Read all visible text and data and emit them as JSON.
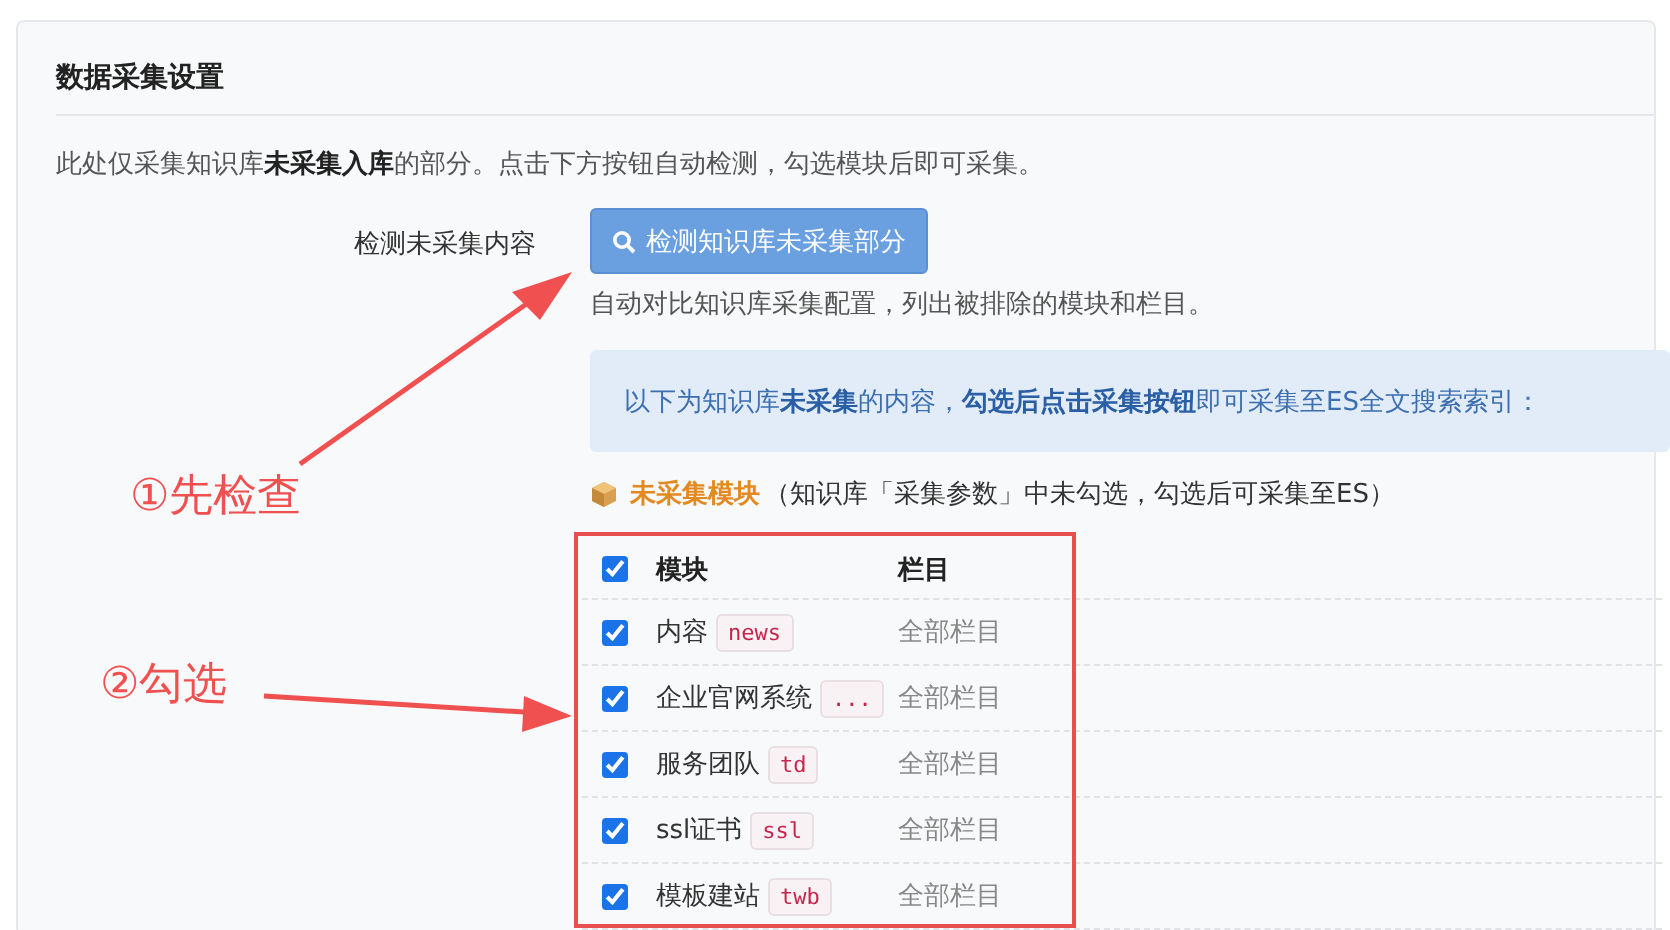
{
  "panel": {
    "title": "数据采集设置",
    "description": "此处仅采集知识库**未采集入库**的部分。点击下方按钮自动检测，勾选模块后即可采集。"
  },
  "detect": {
    "label": "检测未采集内容",
    "button": "检测知识库未采集部分",
    "help": "自动对比知识库采集配置，列出被排除的模块和栏目。"
  },
  "notice": "以下为知识库**未采集**的内容，**勾选后点击采集按钮**即可采集至ES全文搜索索引：",
  "section": {
    "title": "未采集模块",
    "note": "（知识库「采集参数」中未勾选，勾选后可采集至ES）"
  },
  "table": {
    "header_checked": true,
    "columns": [
      "模块",
      "栏目"
    ],
    "rows": [
      {
        "module": "内容",
        "code": "news",
        "column": "全部栏目",
        "checked": true
      },
      {
        "module": "企业官网系统",
        "code": "...",
        "column": "全部栏目",
        "checked": true
      },
      {
        "module": "服务团队",
        "code": "td",
        "column": "全部栏目",
        "checked": true
      },
      {
        "module": "ssl证书",
        "code": "ssl",
        "column": "全部栏目",
        "checked": true
      },
      {
        "module": "模板建站",
        "code": "twb",
        "column": "全部栏目",
        "checked": true
      }
    ]
  },
  "annotations": [
    "①先检查",
    "②勾选"
  ]
}
